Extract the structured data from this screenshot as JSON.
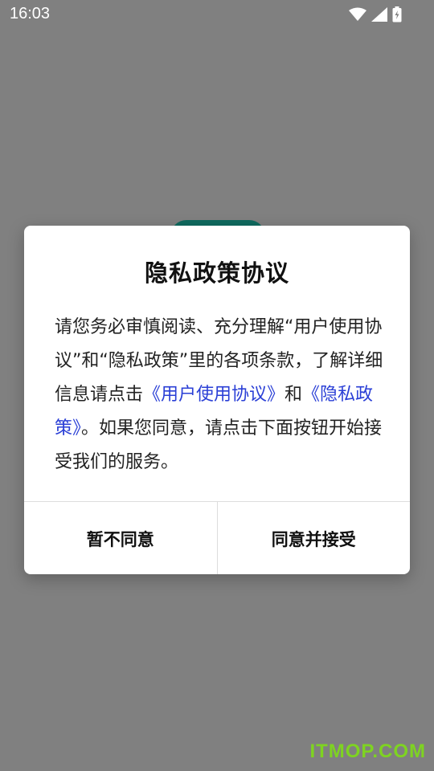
{
  "status_bar": {
    "time": "16:03",
    "icons": [
      "wifi-icon",
      "cellular-signal-icon",
      "battery-charging-icon"
    ]
  },
  "dialog": {
    "title": "隐私政策协议",
    "body": {
      "part1": "请您务必审慎阅读、充分理解“用户使用协议”和“隐私政策”里的各项条款，了解详细信息请点击",
      "link_user_agreement": "《用户使用协议》",
      "and": "和",
      "link_privacy_policy": "《隐私政策》",
      "part2": "。如果您同意，请点击下面按钮开始接受我们的服务。"
    },
    "buttons": {
      "decline": "暂不同意",
      "accept": "同意并接受"
    }
  },
  "watermark": "ITMOP.COM",
  "colors": {
    "overlay": "#808080",
    "dialog_bg": "#ffffff",
    "link": "#2a3fd6",
    "logo_teal": "#0f6a5f",
    "watermark_green": "#7ed321"
  }
}
